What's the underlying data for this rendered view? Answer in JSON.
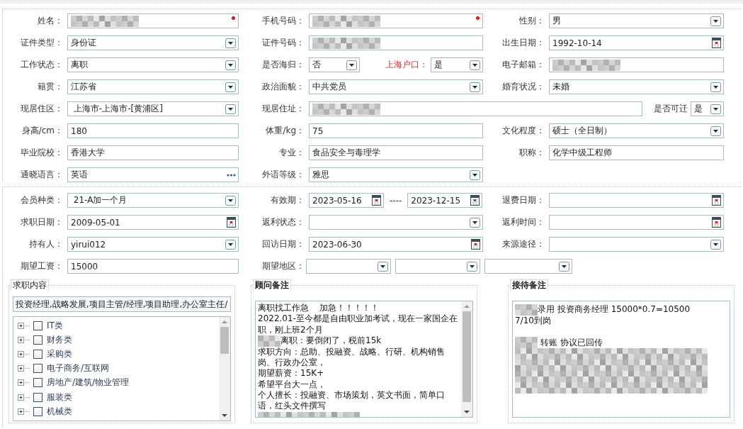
{
  "personal_rows": [
    {
      "fields": [
        {
          "label": "姓名：",
          "kind": "text",
          "redacted": true,
          "required": true
        },
        {
          "label": "手机号码：",
          "kind": "text",
          "redacted": true,
          "required": true
        },
        {
          "label": "性别：",
          "kind": "select",
          "value": "男"
        }
      ]
    },
    {
      "fields": [
        {
          "label": "证件类型：",
          "kind": "select",
          "value": "身份证"
        },
        {
          "label": "证件号码：",
          "kind": "text",
          "redacted": true
        },
        {
          "label": "出生日期：",
          "kind": "date",
          "value": "1992-10-14"
        }
      ]
    },
    {
      "fields": [
        {
          "label": "工作状态：",
          "kind": "select",
          "value": "离职"
        },
        {
          "label": "是否海归：",
          "kind": "select",
          "value": "否",
          "extra": {
            "label": "上海户口：",
            "kind": "select",
            "value": "是",
            "highlight": true
          }
        },
        {
          "label": "电子邮箱：",
          "kind": "text",
          "redacted": true
        }
      ]
    },
    {
      "fields": [
        {
          "label": "籍贯：",
          "kind": "select",
          "value": "江苏省"
        },
        {
          "label": "政治面貌：",
          "kind": "select",
          "value": "中共党员"
        },
        {
          "label": "婚育状况：",
          "kind": "select",
          "value": "未婚"
        }
      ]
    },
    {
      "fields": [
        {
          "label": "现居住区：",
          "kind": "select",
          "value": " 上海市-上海市-[黄浦区]"
        },
        {
          "label": "现居住址：",
          "kind": "text",
          "redacted": true,
          "extra": {
            "label": "是否可迁",
            "kind": "select",
            "value": "是"
          }
        }
      ]
    },
    {
      "fields": [
        {
          "label": "身高/cm：",
          "kind": "text",
          "value": "180"
        },
        {
          "label": "体重/kg：",
          "kind": "text",
          "value": "75"
        },
        {
          "label": "文化程度：",
          "kind": "select",
          "value": "硕士（全日制）"
        }
      ]
    },
    {
      "fields": [
        {
          "label": "毕业院校：",
          "kind": "text",
          "value": "香港大学"
        },
        {
          "label": "专业：",
          "kind": "text",
          "value": "食品安全与毒理学"
        },
        {
          "label": "职称：",
          "kind": "text",
          "value": "化学中级工程师"
        }
      ]
    },
    {
      "fields": [
        {
          "label": "通晓语言：",
          "kind": "lookup",
          "value": "英语"
        },
        {
          "label": "外语等级：",
          "kind": "select",
          "value": "雅思"
        }
      ]
    }
  ],
  "member_rows": [
    {
      "fields": [
        {
          "label": "会员种类：",
          "kind": "select",
          "value": " 21-A加一个月"
        },
        {
          "label": "有效期：",
          "kind": "date_range",
          "value": "2023-05-16",
          "separator": "----",
          "value_to": "2023-12-15"
        },
        {
          "label": "退费日期：",
          "kind": "date"
        }
      ]
    },
    {
      "fields": [
        {
          "label": "求职日期：",
          "kind": "date",
          "value": "2009-05-01"
        },
        {
          "label": "返利状态：",
          "kind": "select"
        },
        {
          "label": "返利时间：",
          "kind": "date"
        }
      ]
    },
    {
      "fields": [
        {
          "label": "持有人：",
          "kind": "select",
          "value": "yirui012"
        },
        {
          "label": "回访日期：",
          "kind": "date",
          "value": "2023-06-30"
        },
        {
          "label": "来源途径：",
          "kind": "select"
        }
      ]
    },
    {
      "fields": [
        {
          "label": "期望工资：",
          "kind": "text",
          "value": "15000"
        },
        {
          "label": "期望地区：",
          "kind": "region"
        }
      ]
    }
  ],
  "job_content": {
    "legend": "求职内容",
    "value": "投资经理,战略发展,项目主管/经理,项目助理,办公室主任/",
    "categories": [
      {
        "label": "IT类",
        "expanded": false,
        "checked": false
      },
      {
        "label": "财务类",
        "expanded": false,
        "checked": false
      },
      {
        "label": "采购类",
        "expanded": false,
        "checked": false
      },
      {
        "label": "电子商务/互联网",
        "expanded": false,
        "checked": false
      },
      {
        "label": "房地产/建筑/物业管理",
        "expanded": false,
        "checked": false
      },
      {
        "label": "服装类",
        "expanded": false,
        "checked": false
      },
      {
        "label": "机械类",
        "expanded": false,
        "checked": false
      }
    ]
  },
  "consultant_notes": {
    "legend": "顾问备注",
    "lines": [
      {
        "kind": "text",
        "text": "离职找工作急    加急！！！！！"
      },
      {
        "kind": "text",
        "text": "2022.01-至今都是自由职业加考试，现在一家国企在职，刚上班2个月"
      },
      {
        "kind": "text",
        "redacted_prefix": true,
        "text": "离职：要倒闭了，税前15k"
      },
      {
        "kind": "text",
        "text": "求职方向：总助、投融资、战略、行研、机构销售岗、行政办公室，"
      },
      {
        "kind": "text",
        "text": "期望薪资：15K+"
      },
      {
        "kind": "text",
        "text": "希望平台大一点，"
      },
      {
        "kind": "text",
        "text": "个人擅长：投融资、市场策划，英文书面，简单口语，红头文件撰写"
      },
      {
        "kind": "redacted"
      }
    ]
  },
  "reception_notes": {
    "legend": "接待备注",
    "lines": [
      {
        "kind": "text",
        "redacted_prefix": true,
        "text": "录用 投资商务经理 15000*0.7=10500"
      },
      {
        "kind": "text",
        "text": "7/10到岗"
      },
      {
        "kind": "blank"
      },
      {
        "kind": "text",
        "redacted_prefix": true,
        "text": " 转账 协议已回传"
      },
      {
        "kind": "redacted"
      },
      {
        "kind": "redacted"
      },
      {
        "kind": "redacted"
      },
      {
        "kind": "redacted"
      }
    ]
  }
}
